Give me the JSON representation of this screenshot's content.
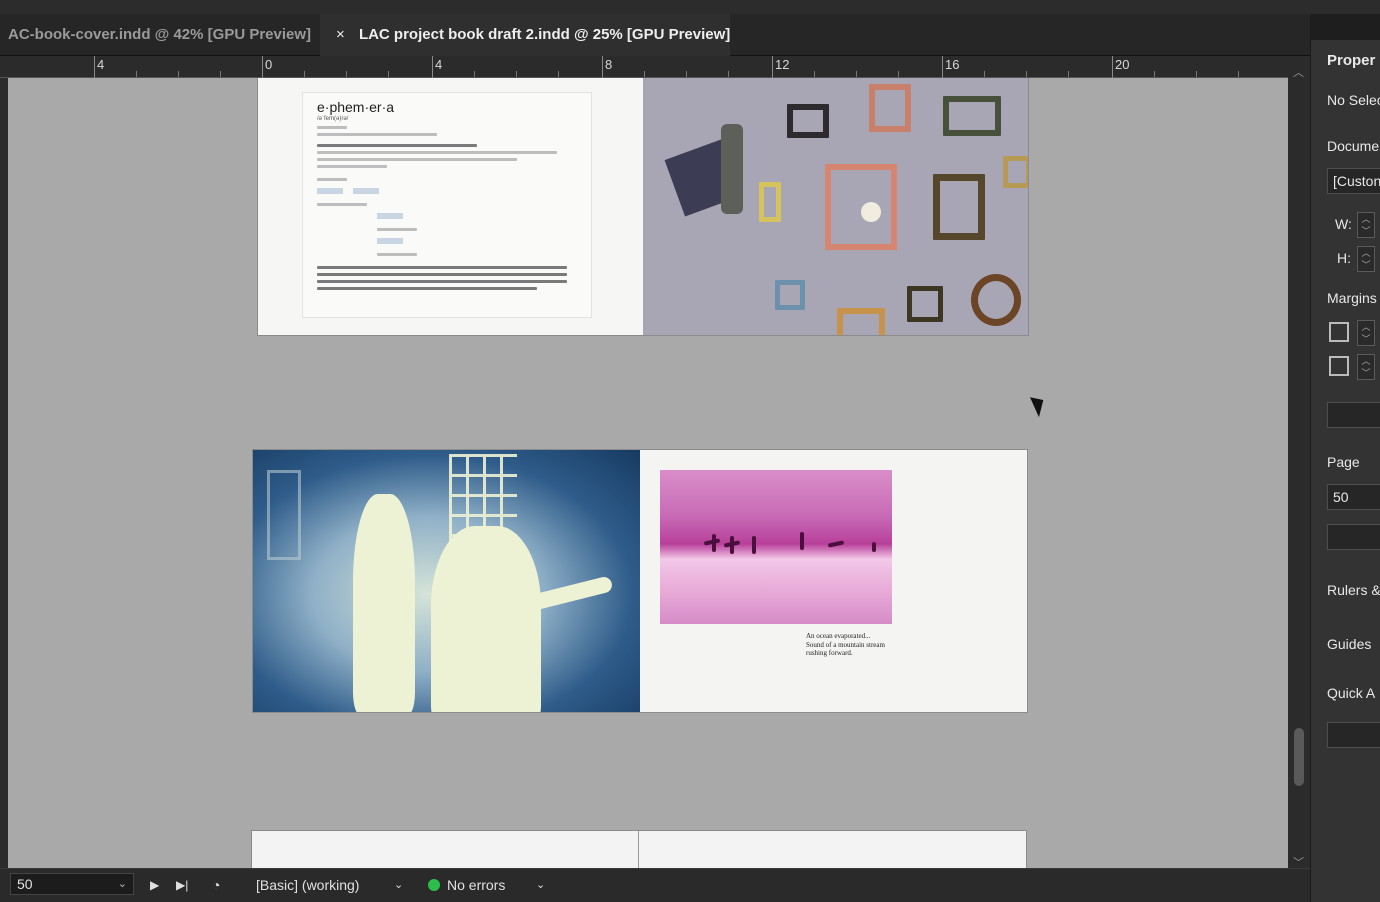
{
  "tabs": [
    {
      "label": "AC-book-cover.indd @ 42% [GPU Preview]",
      "active": false
    },
    {
      "label": "LAC project book draft 2.indd @ 25% [GPU Preview]",
      "active": true,
      "close": "×"
    }
  ],
  "ruler": {
    "labels": [
      "4",
      "0",
      "4",
      "8",
      "12",
      "16",
      "20"
    ]
  },
  "document": {
    "dictionary_page": {
      "word": "e·phem·er·a",
      "pronunciation": "/əˈfem(ə)rə/"
    },
    "surf_page": {
      "caption_lines": [
        "An ocean evaporated...",
        "Sound of a mountain stream",
        "rushing forward."
      ]
    }
  },
  "status_bar": {
    "page_number": "50",
    "preflight_profile": "[Basic] (working)",
    "errors": "No errors",
    "error_status_color": "#2cbd4a"
  },
  "properties_panel": {
    "title": "Proper",
    "selection": "No Selec",
    "document_label": "Docume",
    "preset": "[Custon",
    "width_label": "W:",
    "height_label": "H:",
    "margins_label": "Margins",
    "page_label": "Page",
    "page_value": "50",
    "rulers_label": "Rulers &",
    "guides_label": "Guides",
    "quick_actions_label": "Quick A"
  },
  "icons": [
    "close-icon",
    "chevron-down-icon",
    "next-page-icon",
    "last-page-icon",
    "preflight-icon",
    "spinner-icon",
    "margin-top-icon",
    "margin-bottom-icon",
    "mouse-cursor-icon"
  ]
}
